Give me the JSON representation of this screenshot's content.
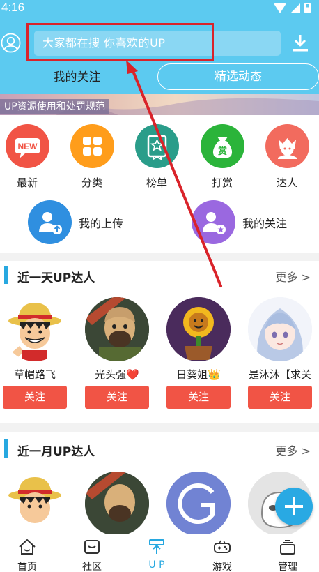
{
  "status": {
    "time": "4:16"
  },
  "search": {
    "placeholder": "大家都在搜  你喜欢的UP"
  },
  "tabs": [
    {
      "label": "我的关注"
    },
    {
      "label": "精选动态"
    }
  ],
  "banner": {
    "text": "UP资源使用和处罚规范"
  },
  "categories": [
    {
      "label": "最新",
      "icon": "new-badge-icon",
      "color": "#f15445"
    },
    {
      "label": "分类",
      "icon": "grid-icon",
      "color": "#ff9d1b"
    },
    {
      "label": "榜单",
      "icon": "ranking-icon",
      "color": "#2a9d8a"
    },
    {
      "label": "打赏",
      "icon": "reward-bag-icon",
      "color": "#2bb43a"
    },
    {
      "label": "达人",
      "icon": "expert-icon",
      "color": "#f26b5e"
    },
    {
      "label": "我的上传",
      "icon": "my-upload-icon",
      "color": "#2f8fe0"
    },
    {
      "label": "我的关注",
      "icon": "my-follow-icon",
      "color": "#9a68e0"
    }
  ],
  "section_day": {
    "title": "近一天UP达人",
    "more": "更多 >",
    "ups": [
      {
        "name": "草帽路飞",
        "follow": "关注",
        "avatar": "luffy"
      },
      {
        "name": "光头强❤️",
        "follow": "关注",
        "avatar": "bald"
      },
      {
        "name": "日葵姐👑",
        "follow": "关注",
        "avatar": "sunflower"
      },
      {
        "name": "是沐沐【求关",
        "follow": "关注",
        "avatar": "anime-girl"
      }
    ]
  },
  "section_month": {
    "title": "近一月UP达人",
    "more": "更多 >"
  },
  "bottom_nav": [
    {
      "label": "首页",
      "icon": "home-icon"
    },
    {
      "label": "社区",
      "icon": "community-icon"
    },
    {
      "label": "U P",
      "icon": "up-icon",
      "active": true
    },
    {
      "label": "游戏",
      "icon": "gamepad-icon"
    },
    {
      "label": "管理",
      "icon": "manage-icon"
    }
  ],
  "colors": {
    "header": "#5ccaf0",
    "accent": "#27a8e0",
    "follow": "#f15445",
    "annotation": "#d9232a"
  }
}
